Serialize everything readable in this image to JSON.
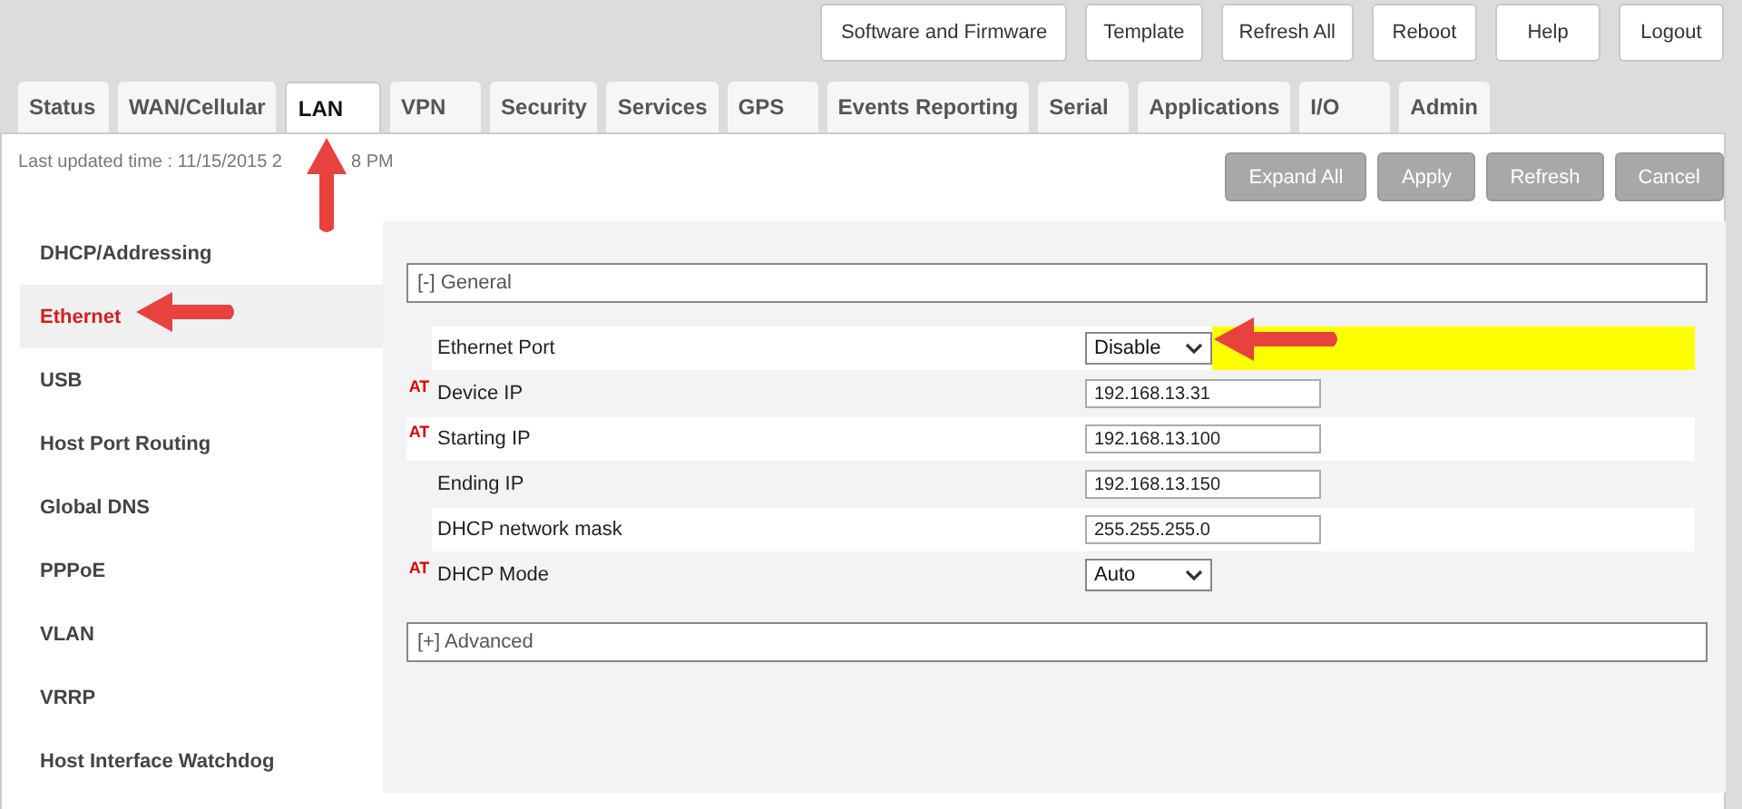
{
  "top_buttons": [
    "Software and Firmware",
    "Template",
    "Refresh All",
    "Reboot",
    "Help",
    "Logout"
  ],
  "tabs": [
    {
      "label": "Status",
      "selected": false
    },
    {
      "label": "WAN/Cellular",
      "selected": false
    },
    {
      "label": "LAN",
      "selected": true
    },
    {
      "label": "VPN",
      "selected": false
    },
    {
      "label": "Security",
      "selected": false
    },
    {
      "label": "Services",
      "selected": false
    },
    {
      "label": "GPS",
      "selected": false
    },
    {
      "label": "Events Reporting",
      "selected": false
    },
    {
      "label": "Serial",
      "selected": false
    },
    {
      "label": "Applications",
      "selected": false
    },
    {
      "label": "I/O",
      "selected": false
    },
    {
      "label": "Admin",
      "selected": false
    }
  ],
  "last_updated": {
    "before_arrow": "Last updated time : 11/15/2015 2",
    "after_arrow": "8 PM"
  },
  "action_buttons": [
    "Expand All",
    "Apply",
    "Refresh",
    "Cancel"
  ],
  "sidebar": {
    "items": [
      {
        "label": "DHCP/Addressing",
        "selected": false
      },
      {
        "label": "Ethernet",
        "selected": true
      },
      {
        "label": "USB",
        "selected": false
      },
      {
        "label": "Host Port Routing",
        "selected": false
      },
      {
        "label": "Global DNS",
        "selected": false
      },
      {
        "label": "PPPoE",
        "selected": false
      },
      {
        "label": "VLAN",
        "selected": false
      },
      {
        "label": "VRRP",
        "selected": false
      },
      {
        "label": "Host Interface Watchdog",
        "selected": false
      }
    ]
  },
  "sections": [
    {
      "label": "[-] General",
      "expanded": true,
      "fields": [
        {
          "label": "Ethernet Port",
          "kind": "select",
          "value": "Disable",
          "highlighted": true
        },
        {
          "label": "Device IP",
          "at_marker": "AT",
          "kind": "input",
          "value": "192.168.13.31",
          "highlighted": false
        },
        {
          "label": "Starting IP",
          "at_marker": "AT",
          "kind": "input",
          "value": "192.168.13.100",
          "highlighted": false
        },
        {
          "label": "Ending IP",
          "kind": "input",
          "value": "192.168.13.150",
          "highlighted": false
        },
        {
          "label": "DHCP network mask",
          "kind": "input",
          "value": "255.255.255.0",
          "highlighted": false
        },
        {
          "label": "DHCP Mode",
          "at_marker": "AT",
          "kind": "select",
          "value": "Auto",
          "highlighted": false
        }
      ]
    },
    {
      "label": "[+] Advanced",
      "expanded": false
    }
  ]
}
